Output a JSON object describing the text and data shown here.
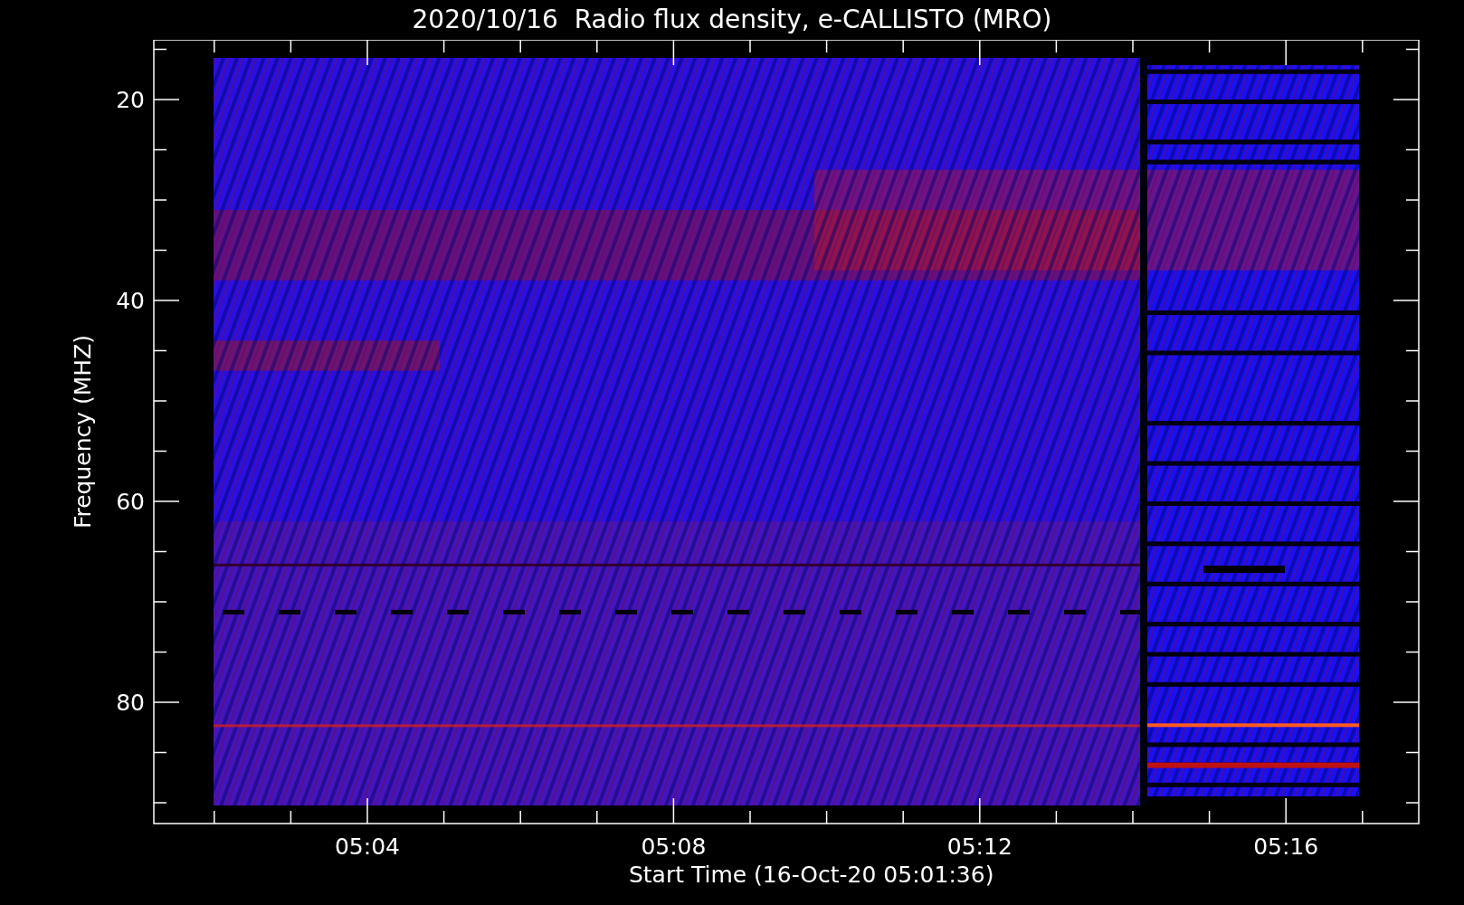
{
  "title": "2020/10/16  Radio flux density, e-CALLISTO (MRO)",
  "y_axis": {
    "label": "Frequency (MHZ)",
    "ticks": [
      "20",
      "40",
      "60",
      "80"
    ]
  },
  "x_axis": {
    "label": "Start Time (16-Oct-20 05:01:36)",
    "ticks": [
      "05:04",
      "05:08",
      "05:12",
      "05:16"
    ]
  }
}
